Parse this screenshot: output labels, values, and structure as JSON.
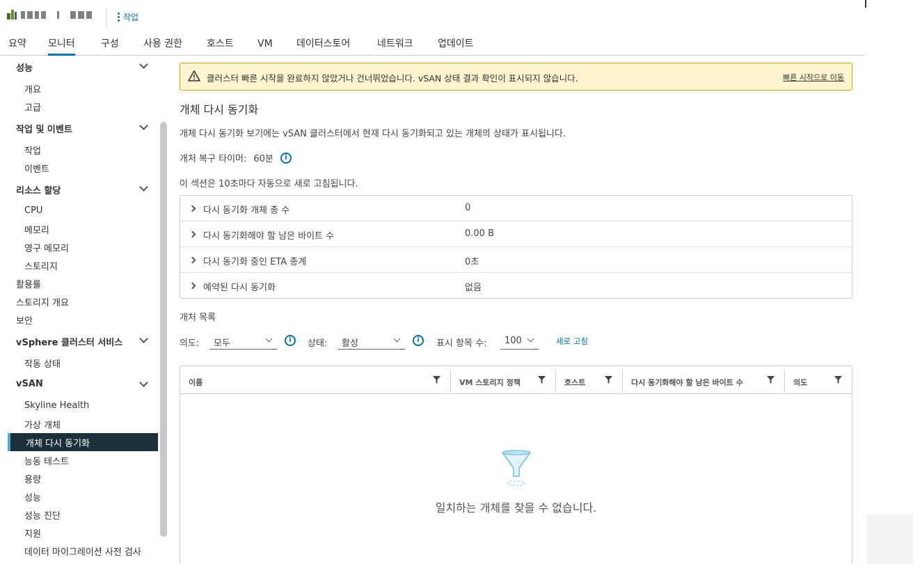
{
  "header": {
    "actions_label": "작업"
  },
  "tabs": [
    "요약",
    "모니터",
    "구성",
    "사용 권한",
    "호스트",
    "VM",
    "데이터스토어",
    "네트워크",
    "업데이트"
  ],
  "active_tab": "모니터",
  "sidebar": {
    "sections": [
      {
        "label": "성능",
        "items": [
          "개요",
          "고급"
        ]
      },
      {
        "label": "작업 및 이벤트",
        "items": [
          "작업",
          "이벤트"
        ]
      },
      {
        "label": "리소스 할당",
        "items": [
          "CPU",
          "메모리",
          "영구 메모리",
          "스토리지"
        ]
      },
      {
        "label": "vSphere 클러스터 서비스",
        "items": [
          "작동 상태"
        ]
      },
      {
        "label": "vSAN",
        "items": [
          "Skyline Health",
          "가상 개체",
          "개체 다시 동기화",
          "능동 테스트",
          "용량",
          "성능",
          "성능 진단",
          "지원",
          "데이터 마이그레이션 사전 검사"
        ]
      }
    ],
    "top_items": [
      "활용률",
      "스토리지 개요",
      "보안"
    ],
    "selected": "개체 다시 동기화"
  },
  "alert": {
    "text": "클러스터 빠른 시작을 완료하지 않았거나 건너뛰었습니다. vSAN 상태 결과 확인이 표시되지 않습니다.",
    "link": "빠른 시작으로 이동",
    "color": "#fdf5cf"
  },
  "main": {
    "title": "개체 다시 동기화",
    "description": "개체 다시 동기화 보기에는 vSAN 클러스터에서 현재 다시 동기화되고 있는 개체의 상태가 표시됩니다.",
    "timer_label": "개처 복구 타이머:",
    "timer_value": "60분",
    "refresh_note": "이 섹션은 10초마다 자동으로 새로 고침됩니다.",
    "stats": [
      {
        "label": "다시 동기화 개체 총 수",
        "value": "0"
      },
      {
        "label": "다시 동기화해야 할 남은 바이트 수",
        "value": "0.00 B"
      },
      {
        "label": "다시 동기화 중인 ETA 총계",
        "value": "0초"
      },
      {
        "label": "예약된 다시 동기화",
        "value": "없음"
      }
    ],
    "object_list_title": "개처 목록",
    "filters": {
      "intent_label": "의도:",
      "intent_value": "모두",
      "status_label": "상태:",
      "status_value": "활성",
      "show_label": "표시 항목 수:",
      "show_value": "100",
      "refresh": "새로 고침"
    },
    "grid": {
      "columns": [
        "이름",
        "VM 스토리지 정책",
        "호스트",
        "다시 동기화해야 할 남은 바이트 수",
        "의도"
      ],
      "empty_text": "일치하는 개체를 찾을 수 없습니다."
    }
  },
  "colors": {
    "accent": "#0072a3",
    "selected_bg": "#1e2f3c",
    "selected_border": "#49afd9"
  }
}
